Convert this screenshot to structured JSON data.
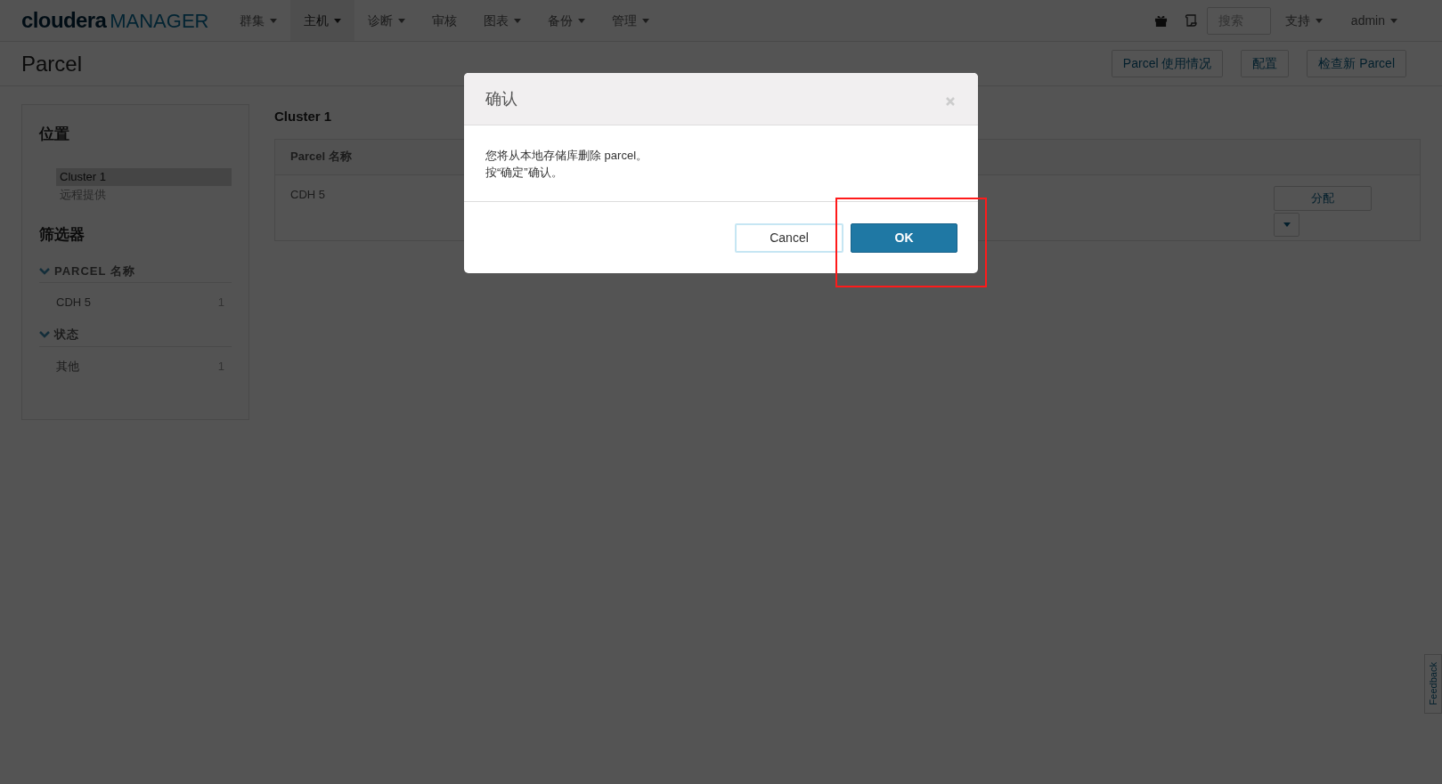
{
  "nav": {
    "logo": {
      "brand": "cloudera",
      "product": "MANAGER"
    },
    "menu": [
      {
        "label": "群集",
        "dropdown": true,
        "selected": false
      },
      {
        "label": "主机",
        "dropdown": true,
        "selected": true
      },
      {
        "label": "诊断",
        "dropdown": true,
        "selected": false
      },
      {
        "label": "审核",
        "dropdown": false,
        "selected": false
      },
      {
        "label": "图表",
        "dropdown": true,
        "selected": false
      },
      {
        "label": "备份",
        "dropdown": true,
        "selected": false
      },
      {
        "label": "管理",
        "dropdown": true,
        "selected": false
      }
    ],
    "search": {
      "placeholder": "搜索"
    },
    "right_menu": [
      {
        "label": "支持",
        "dropdown": true
      },
      {
        "label": "admin",
        "dropdown": true
      }
    ]
  },
  "page": {
    "title": "Parcel",
    "actions": [
      "Parcel 使用情况",
      "配置",
      "检查新 Parcel"
    ]
  },
  "sidebar": {
    "location": {
      "heading": "位置",
      "items": [
        {
          "label": "Cluster 1",
          "selected": true
        },
        {
          "label": "远程提供",
          "selected": false
        }
      ]
    },
    "filters": {
      "heading": "筛选器",
      "groups": [
        {
          "title": "PARCEL 名称",
          "expanded": true,
          "items": [
            {
              "label": "CDH 5",
              "count": "1"
            }
          ]
        },
        {
          "title": "状态",
          "expanded": true,
          "items": [
            {
              "label": "其他",
              "count": "1"
            }
          ]
        }
      ]
    }
  },
  "main": {
    "cluster": "Cluster 1",
    "table": {
      "columns": [
        "Parcel 名称"
      ],
      "rows": [
        {
          "name": "CDH 5",
          "action": "分配"
        }
      ]
    }
  },
  "dialog": {
    "title": "确认",
    "lines": [
      "您将从本地存储库删除 parcel。",
      "按“确定”确认。"
    ],
    "buttons": [
      {
        "label": "Cancel",
        "kind": "secondary"
      },
      {
        "label": "OK",
        "kind": "primary"
      }
    ]
  },
  "feedback": "Feedback"
}
